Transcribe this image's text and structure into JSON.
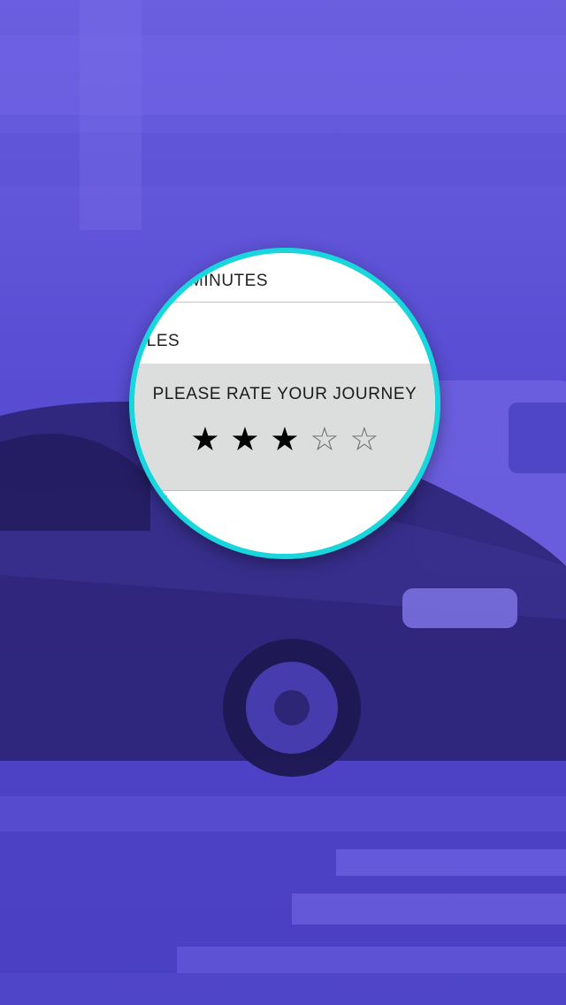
{
  "magnifier": {
    "ring_color": "#19d6dc",
    "rows": {
      "minutes_label": "MINUTES",
      "miles_label": "ILES"
    },
    "rating": {
      "title": "PLEASE RATE YOUR JOURNEY",
      "value": 3,
      "max": 5,
      "stars": [
        {
          "glyph": "★",
          "filled": true
        },
        {
          "glyph": "★",
          "filled": true
        },
        {
          "glyph": "★",
          "filled": true
        },
        {
          "glyph": "☆",
          "filled": false
        },
        {
          "glyph": "☆",
          "filled": false
        }
      ]
    }
  },
  "background": {
    "tint_color": "#5a4ed4",
    "scene": "blurred-car-street"
  }
}
